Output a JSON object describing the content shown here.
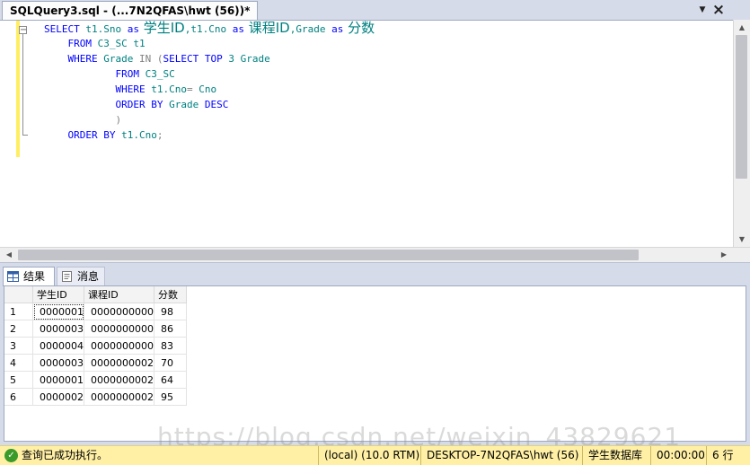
{
  "tab": {
    "title": "SQLQuery3.sql - (...7N2QFAS\\hwt (56))*"
  },
  "code": {
    "l1": {
      "k1": "SELECT",
      "t1": " t1.Sno ",
      "k2": "as",
      "c1": " 学生ID",
      "t2": ",t1.Cno ",
      "k3": "as",
      "c2": " 课程ID",
      "t3": ",Grade ",
      "k4": "as",
      "c3": " 分数"
    },
    "l2": {
      "k1": "FROM",
      "t1": " C3_SC t1"
    },
    "l3": {
      "k1": "WHERE",
      "t1": " Grade ",
      "g1": "IN",
      "g2": " (",
      "k2": "SELECT TOP",
      "t2": " 3 Grade"
    },
    "l4": {
      "k1": "FROM",
      "t1": " C3_SC"
    },
    "l5": {
      "k1": "WHERE",
      "t1": " t1.Cno",
      "g1": "=",
      "t2": " Cno"
    },
    "l6": {
      "k1": "ORDER BY",
      "t1": " Grade ",
      "k2": "DESC"
    },
    "l7": {
      "g1": ")"
    },
    "l8": {
      "k1": "ORDER BY",
      "t1": " t1.Cno",
      "g1": ";"
    }
  },
  "results_tabs": {
    "results": "结果",
    "messages": "消息"
  },
  "grid": {
    "headers": [
      "学生ID",
      "课程ID",
      "分数"
    ],
    "rows": [
      {
        "n": "1",
        "sno": "0000001",
        "cno": "0000000000",
        "grade": "98"
      },
      {
        "n": "2",
        "sno": "0000003",
        "cno": "0000000000",
        "grade": "86"
      },
      {
        "n": "3",
        "sno": "0000004",
        "cno": "0000000000",
        "grade": "83"
      },
      {
        "n": "4",
        "sno": "0000003",
        "cno": "0000000002",
        "grade": "70"
      },
      {
        "n": "5",
        "sno": "0000001",
        "cno": "0000000002",
        "grade": "64"
      },
      {
        "n": "6",
        "sno": "0000002",
        "cno": "0000000002",
        "grade": "95"
      }
    ]
  },
  "status": {
    "message": "查询已成功执行。",
    "server": "(local) (10.0 RTM)",
    "connection": "DESKTOP-7N2QFAS\\hwt (56)",
    "database": "学生数据库",
    "elapsed": "00:00:00",
    "rows": "6 行"
  },
  "watermark": "https://blog.csdn.net/weixin_43829621",
  "colors": {
    "keyword": "#0000ff",
    "text": "#008080",
    "operator": "#808080",
    "status_bar": "#fff0a6",
    "success": "#3a9a2a"
  }
}
